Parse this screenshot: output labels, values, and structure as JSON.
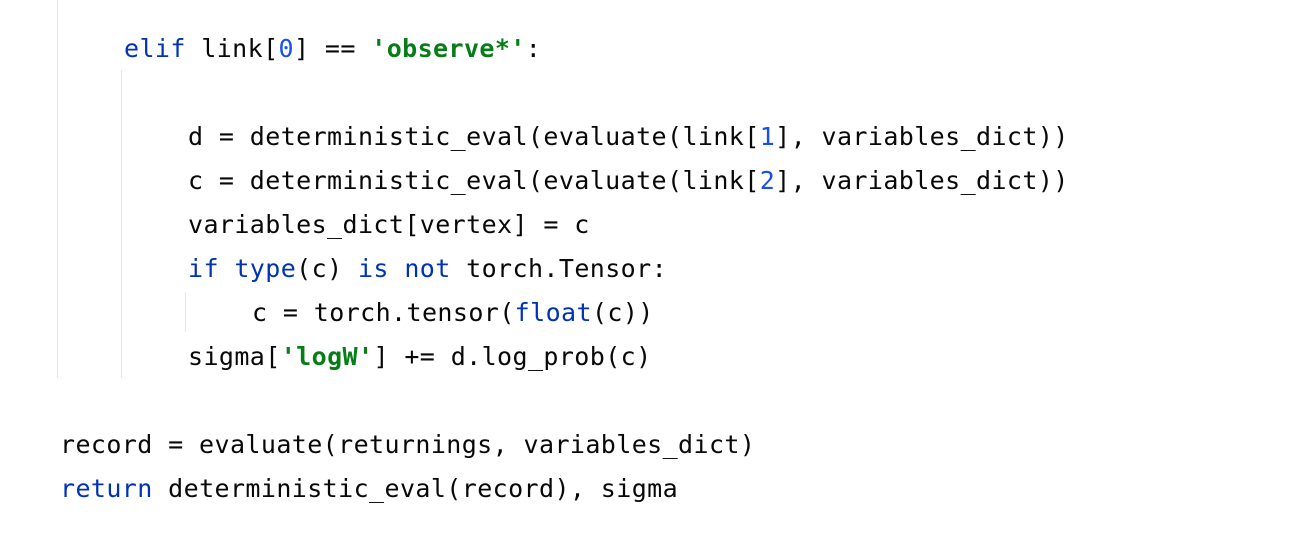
{
  "editor": {
    "language": "python",
    "lines": [
      {
        "tokens": [
          {
            "t": "elif",
            "c": "kw"
          },
          {
            "t": " link[",
            "c": ""
          },
          {
            "t": "0",
            "c": "num"
          },
          {
            "t": "] == ",
            "c": ""
          },
          {
            "t": "'observe*'",
            "c": "str"
          },
          {
            "t": ":",
            "c": ""
          }
        ]
      },
      {
        "tokens": []
      },
      {
        "tokens": [
          {
            "t": "d = deterministic_eval(evaluate(link[",
            "c": ""
          },
          {
            "t": "1",
            "c": "num"
          },
          {
            "t": "], variables_dict))",
            "c": ""
          }
        ]
      },
      {
        "tokens": [
          {
            "t": "c = deterministic_eval(evaluate(link[",
            "c": ""
          },
          {
            "t": "2",
            "c": "num"
          },
          {
            "t": "], variables_dict))",
            "c": ""
          }
        ]
      },
      {
        "tokens": [
          {
            "t": "variables_dict[vertex] = c",
            "c": ""
          }
        ]
      },
      {
        "tokens": [
          {
            "t": "if",
            "c": "kw"
          },
          {
            "t": " ",
            "c": ""
          },
          {
            "t": "type",
            "c": "bi"
          },
          {
            "t": "(c) ",
            "c": ""
          },
          {
            "t": "is",
            "c": "kw"
          },
          {
            "t": " ",
            "c": ""
          },
          {
            "t": "not",
            "c": "kw"
          },
          {
            "t": " torch.Tensor:",
            "c": ""
          }
        ]
      },
      {
        "tokens": [
          {
            "t": "c = torch.tensor(",
            "c": ""
          },
          {
            "t": "float",
            "c": "bi"
          },
          {
            "t": "(c))",
            "c": ""
          }
        ]
      },
      {
        "tokens": [
          {
            "t": "sigma[",
            "c": ""
          },
          {
            "t": "'logW'",
            "c": "str"
          },
          {
            "t": "] += d.log_prob(c)",
            "c": ""
          }
        ]
      },
      {
        "tokens": []
      },
      {
        "tokens": [
          {
            "t": "record = evaluate(returnings, variables_dict)",
            "c": ""
          }
        ]
      },
      {
        "tokens": [
          {
            "t": "return",
            "c": "kw"
          },
          {
            "t": " deterministic_eval(record), sigma",
            "c": ""
          }
        ]
      }
    ]
  },
  "colors": {
    "background": "#ffffff",
    "text": "#080808",
    "keyword": "#0033b3",
    "number": "#1750eb",
    "string": "#067d17",
    "indent_guide": "#e6e6e6"
  }
}
